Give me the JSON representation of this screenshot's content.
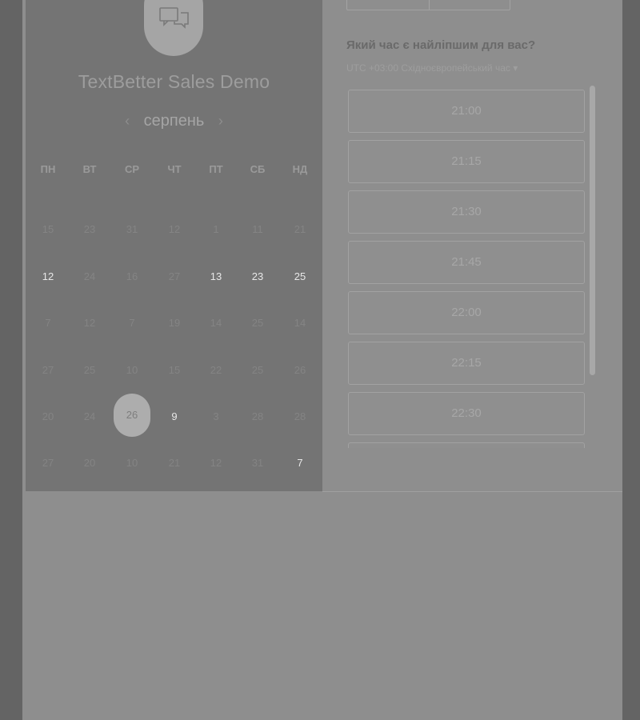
{
  "header": {
    "title": "TextBetter Sales Demo",
    "month": "серпень",
    "prev_icon": "‹",
    "next_icon": "›"
  },
  "calendar": {
    "weekdays": [
      "ПН",
      "ВТ",
      "СР",
      "ЧТ",
      "ПТ",
      "СБ",
      "НД"
    ],
    "weeks": [
      [
        "15",
        "23",
        "31",
        "12",
        "1",
        "11",
        "21"
      ],
      [
        "12",
        "24",
        "16",
        "27",
        "13",
        "23",
        "25"
      ],
      [
        "7",
        "12",
        "7",
        "19",
        "14",
        "25",
        "14"
      ],
      [
        "27",
        "25",
        "10",
        "15",
        "22",
        "25",
        "26"
      ],
      [
        "20",
        "24",
        "26",
        "9",
        "3",
        "28",
        "28"
      ],
      [
        "27",
        "20",
        "10",
        "21",
        "12",
        "31",
        "7"
      ]
    ],
    "selected_day": "26"
  },
  "booking": {
    "question": "Який час є найліпшим для вас?",
    "timezone": "UTC +03:00 Східноєвропейський час ▾",
    "slots": [
      "21:00",
      "21:15",
      "21:30",
      "21:45",
      "22:00",
      "22:15",
      "22:30",
      ""
    ]
  },
  "icons": {
    "avatar": "chat-bubbles-icon"
  }
}
